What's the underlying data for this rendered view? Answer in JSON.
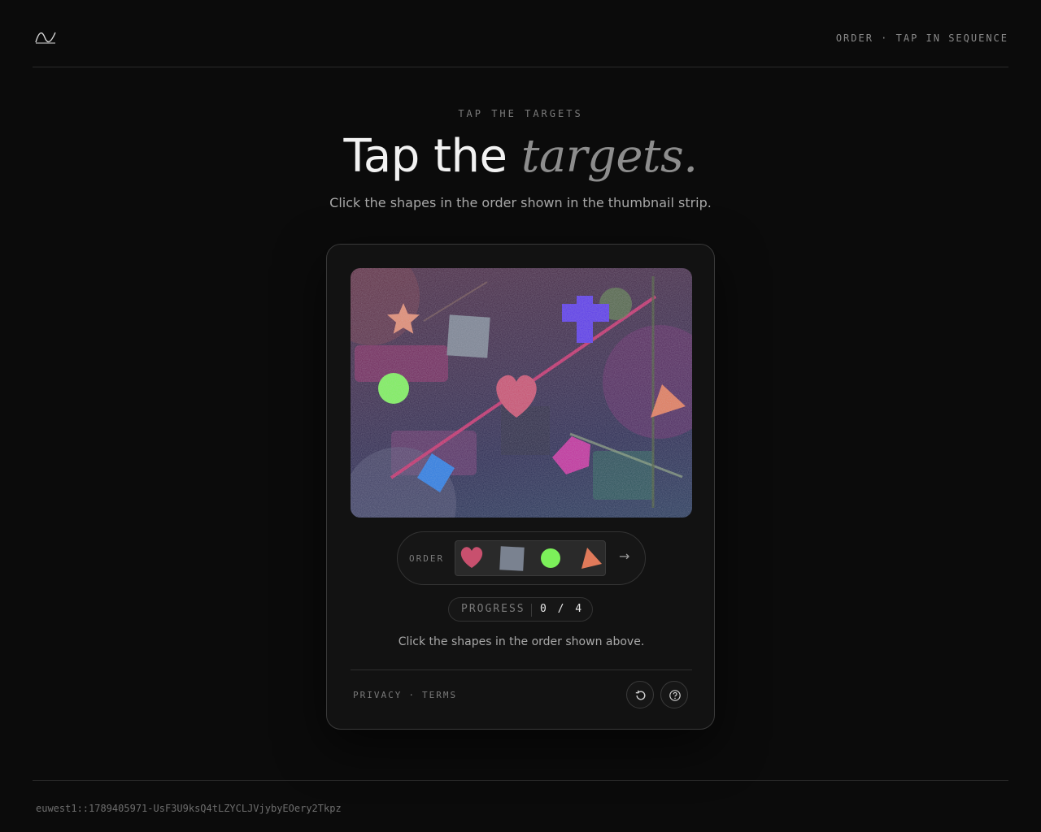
{
  "header": {
    "tagline": "ORDER · TAP IN SEQUENCE"
  },
  "hero": {
    "eyebrow": "TAP THE TARGETS",
    "title_plain": "Tap the",
    "title_emphasis": "targets.",
    "subtitle": "Click the shapes in the order shown in the thumbnail strip."
  },
  "challenge": {
    "order_label": "ORDER",
    "order_sequence": [
      "heart",
      "square",
      "circle",
      "triangle"
    ],
    "next_arrow": "→",
    "progress_label": "PROGRESS",
    "progress_value": "0 / 4",
    "instruction": "Click the shapes in the order shown above."
  },
  "footer_links": {
    "privacy": "PRIVACY",
    "separator": "·",
    "terms": "TERMS"
  },
  "icons": {
    "reload": "reload-icon",
    "help": "help-icon",
    "logo": "wave-logo"
  },
  "session_id": "euwest1::1789405971-UsF3U9ksQ4tLZYCLJVjybyEOery2Tkpz",
  "colors": {
    "background": "#0b0b0b",
    "card": "#121212",
    "heart": "#c8506e",
    "square": "#7a8290",
    "circle": "#7cf05a",
    "triangle": "#e07a5a",
    "star": "#e08a70",
    "plus": "#5a3ae8",
    "pentagon": "#c0309a",
    "diamond": "#2a7ae0"
  }
}
